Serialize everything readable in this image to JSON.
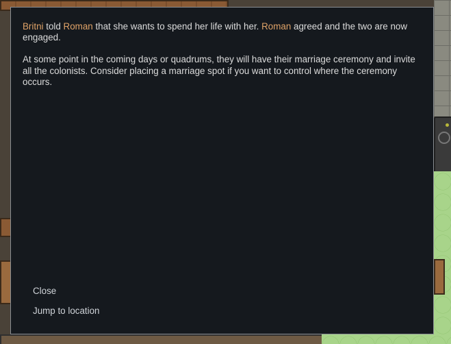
{
  "letter": {
    "paragraph1": {
      "pawn_a": "Britni",
      "text_1": " told ",
      "pawn_b": "Roman",
      "text_2": " that she wants to spend her life with her. ",
      "pawn_c": "Roman",
      "text_3": " agreed and the two are now engaged."
    },
    "paragraph2": "At some point in the coming days or quadrums, they will have their marriage ceremony and invite all the colonists. Consider placing a marriage spot if you want to control where the ceremony occurs.",
    "options": {
      "close": "Close",
      "jump": "Jump to location"
    }
  },
  "colors": {
    "dialog_bg": "#15191e",
    "dialog_border": "#8a8e93",
    "text": "#dcdcdc",
    "pawn_name": "#e0a368",
    "option_text": "#cfd3d8"
  }
}
